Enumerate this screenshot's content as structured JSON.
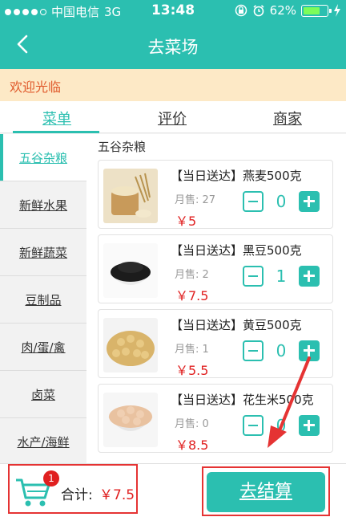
{
  "status_bar": {
    "carrier": "中国电信",
    "network": "3G",
    "time": "13:48",
    "battery": "62%",
    "battery_level": 0.62
  },
  "navbar": {
    "title": "去菜场",
    "back_icon": "chevron-left-icon"
  },
  "welcome": "欢迎光临",
  "tabs": [
    {
      "label": "菜单",
      "active": true
    },
    {
      "label": "评价",
      "active": false
    },
    {
      "label": "商家",
      "active": false
    }
  ],
  "categories": [
    "五谷杂粮",
    "新鲜水果",
    "新鲜蔬菜",
    "豆制品",
    "肉/蛋/禽",
    "卤菜",
    "水产/海鲜"
  ],
  "active_category": "五谷杂粮",
  "section_title": "五谷杂粮",
  "products": [
    {
      "name": "【当日送达】燕麦500克",
      "sold": "月售: 27",
      "price": "￥5",
      "qty": "0"
    },
    {
      "name": "【当日送达】黑豆500克",
      "sold": "月售: 2",
      "price": "￥7.5",
      "qty": "1"
    },
    {
      "name": "【当日送达】黄豆500克",
      "sold": "月售: 1",
      "price": "￥5.5",
      "qty": "0"
    },
    {
      "name": "【当日送达】花生米500克",
      "sold": "月售: 0",
      "price": "￥8.5",
      "qty": "0"
    }
  ],
  "cart": {
    "badge": "1",
    "total_label": "合计:",
    "total_value": "￥7.5"
  },
  "checkout": {
    "label": "去结算"
  },
  "colors": {
    "accent": "#2bbfb0",
    "price": "#e02020",
    "banner_bg": "#fde9c6",
    "annotation": "#e53333"
  }
}
